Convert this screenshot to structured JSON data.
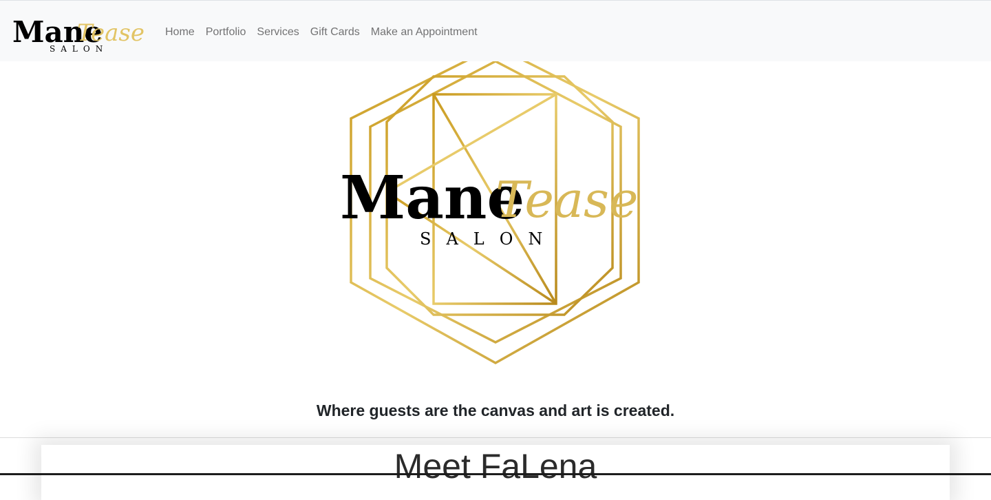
{
  "brand": {
    "name_main": "Mane",
    "name_script": "Tease",
    "name_sub": "SALON"
  },
  "nav": {
    "items": [
      {
        "label": "Home"
      },
      {
        "label": "Portfolio"
      },
      {
        "label": "Services"
      },
      {
        "label": "Gift Cards"
      },
      {
        "label": "Make an Appointment"
      }
    ]
  },
  "hero": {
    "logo_main": "Mane",
    "logo_script": "Tease",
    "logo_sub": "SALON",
    "tagline": "Where guests are the canvas and art is created."
  },
  "section": {
    "title": "Meet FaLena"
  },
  "colors": {
    "gold": "#c9a227",
    "gold_light": "#e8c766",
    "navbar_bg": "#f8f9fa",
    "text": "#212529"
  }
}
